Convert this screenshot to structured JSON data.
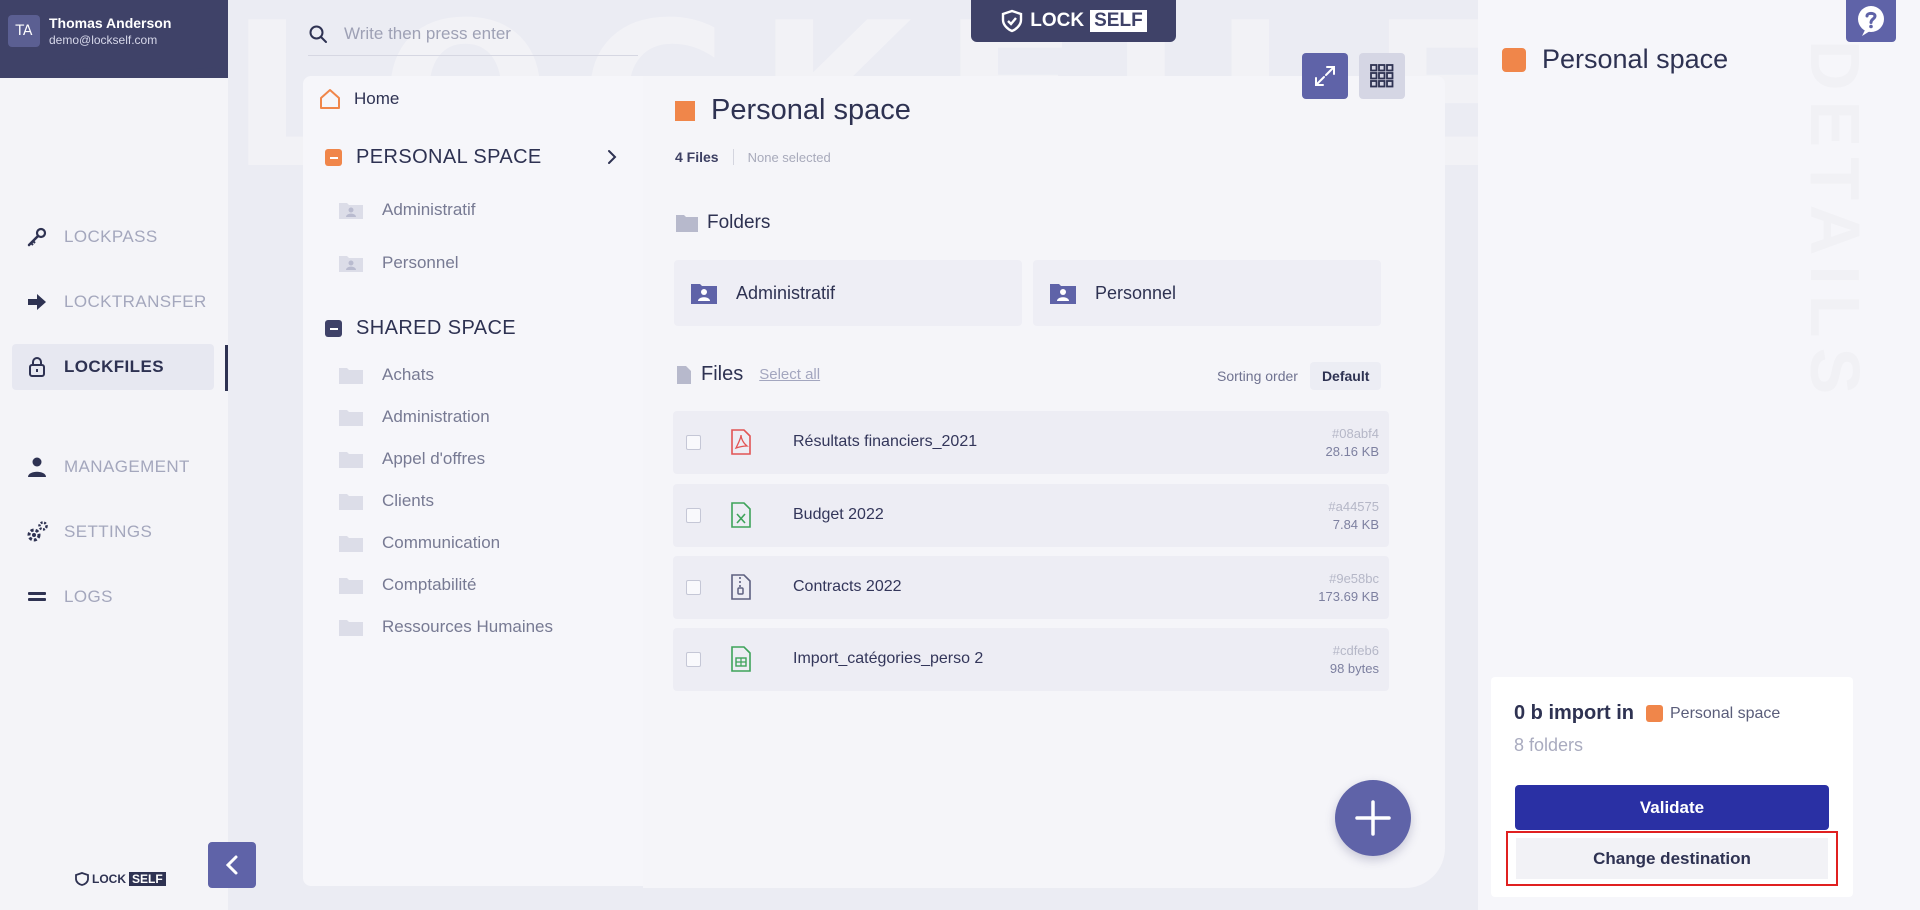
{
  "user": {
    "initials": "TA",
    "name": "Thomas Anderson",
    "email": "demo@lockself.com"
  },
  "nav": {
    "items": [
      {
        "label": "LOCKPASS",
        "icon": "key-icon"
      },
      {
        "label": "LOCKTRANSFER",
        "icon": "arrow-right-icon"
      },
      {
        "label": "LOCKFILES",
        "icon": "lock-icon",
        "active": true
      },
      {
        "label": "MANAGEMENT",
        "icon": "user-icon"
      },
      {
        "label": "SETTINGS",
        "icon": "gears-icon"
      },
      {
        "label": "LOGS",
        "icon": "logs-icon"
      }
    ]
  },
  "brand": {
    "lock": "LOCK",
    "self": "SELF"
  },
  "search": {
    "placeholder": "Write then press enter"
  },
  "watermark": "LOCKFILES",
  "watermark_right": "DETAILS",
  "tree": {
    "home": "Home",
    "personal_space": {
      "label": "PERSONAL SPACE",
      "folders": [
        "Administratif",
        "Personnel"
      ]
    },
    "shared_space": {
      "label": "SHARED SPACE",
      "folders": [
        "Achats",
        "Administration",
        "Appel d'offres",
        "Clients",
        "Communication",
        "Comptabilité",
        "Ressources Humaines"
      ]
    }
  },
  "main": {
    "title": "Personal space",
    "files_count": "4 Files",
    "selection": "None selected",
    "folders_heading": "Folders",
    "folders": [
      "Administratif",
      "Personnel"
    ],
    "files_heading": "Files",
    "select_all": "Select all",
    "sorting_label": "Sorting order",
    "sorting_value": "Default",
    "files": [
      {
        "name": "Résultats financiers_2021",
        "hash": "#08abf4",
        "size": "28.16 KB",
        "type": "pdf"
      },
      {
        "name": "Budget 2022",
        "hash": "#a44575",
        "size": "7.84 KB",
        "type": "excel"
      },
      {
        "name": "Contracts 2022",
        "hash": "#9e58bc",
        "size": "173.69 KB",
        "type": "zip"
      },
      {
        "name": "Import_catégories_perso 2",
        "hash": "#cdfeb6",
        "size": "98 bytes",
        "type": "csv"
      }
    ]
  },
  "details": {
    "title": "Personal space",
    "import_amount": "0 b import in",
    "import_target": "Personal space",
    "folders_count": "8 folders",
    "validate_label": "Validate",
    "change_destination_label": "Change destination"
  },
  "colors": {
    "accent": "#5f63a8",
    "navy": "#3f4268",
    "orange": "#f0864a",
    "validate": "#2a30a4",
    "highlight": "#e02020"
  }
}
